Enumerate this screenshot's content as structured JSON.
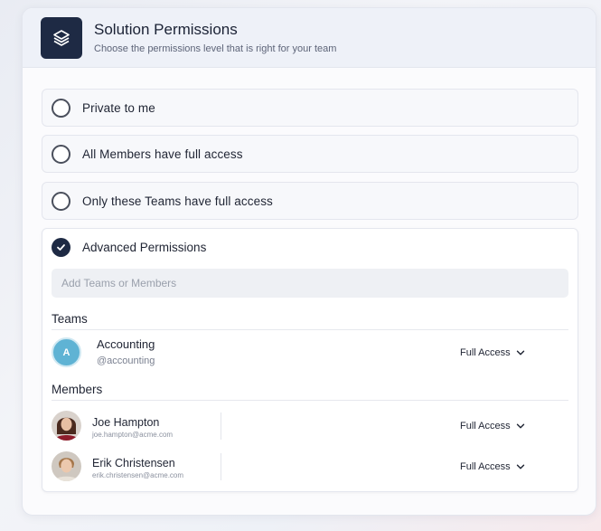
{
  "header": {
    "title": "Solution Permissions",
    "subtitle": "Choose the permissions level that is right for your team",
    "logo_icon": "stacked-layers-icon"
  },
  "options": [
    {
      "label": "Private to me",
      "selected": false
    },
    {
      "label": "All Members have full access",
      "selected": false
    },
    {
      "label": "Only these Teams have full access",
      "selected": false
    }
  ],
  "advanced": {
    "label": "Advanced Permissions",
    "selected": true,
    "search_placeholder": "Add Teams or Members",
    "teams_title": "Teams",
    "members_title": "Members",
    "teams": [
      {
        "initial": "A",
        "name": "Accounting",
        "handle": "@accounting",
        "access": "Full Access"
      }
    ],
    "members": [
      {
        "name": "Joe Hampton",
        "email": "joe.hampton@acme.com",
        "access": "Full Access"
      },
      {
        "name": "Erik Christensen",
        "email": "erik.christensen@acme.com",
        "access": "Full Access"
      }
    ]
  },
  "colors": {
    "brand_dark": "#1e2a44",
    "team_avatar": "#5fb3d4"
  }
}
